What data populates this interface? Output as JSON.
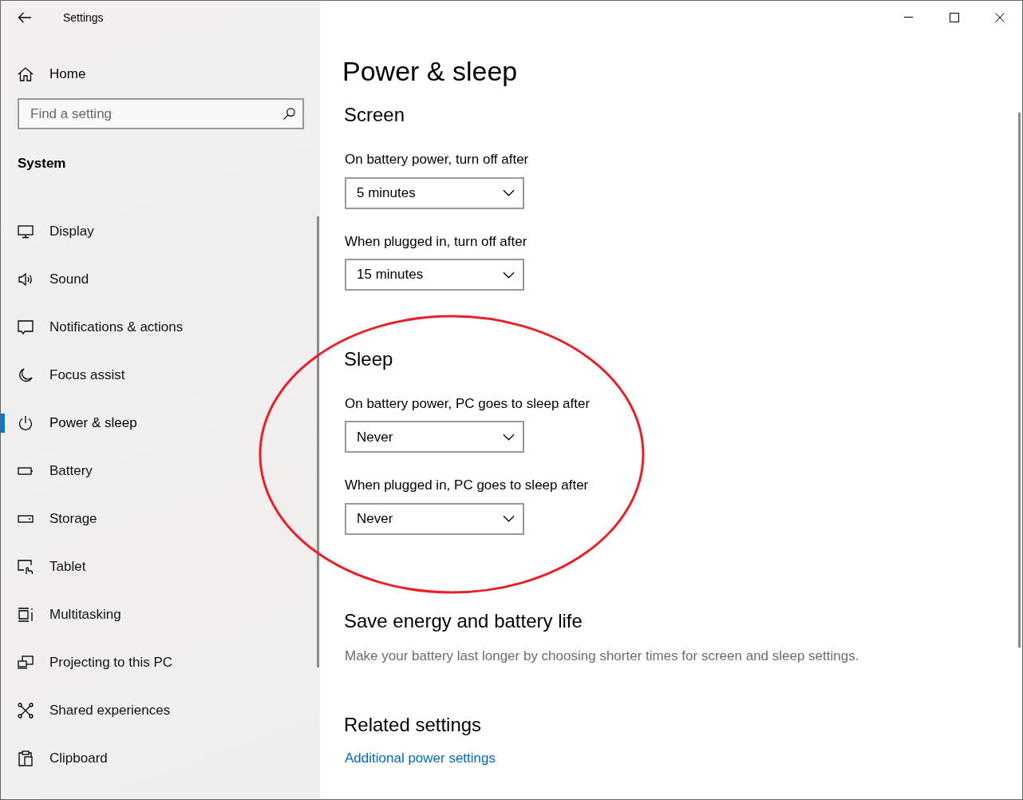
{
  "window": {
    "title": "Settings"
  },
  "sidebar": {
    "home": "Home",
    "search": {
      "placeholder": "Find a setting"
    },
    "section": "System",
    "items": [
      {
        "kind": "display",
        "label": "Display",
        "selected": false
      },
      {
        "kind": "sound",
        "label": "Sound",
        "selected": false
      },
      {
        "kind": "notifications",
        "label": "Notifications & actions",
        "selected": false
      },
      {
        "kind": "focus",
        "label": "Focus assist",
        "selected": false
      },
      {
        "kind": "power",
        "label": "Power & sleep",
        "selected": true
      },
      {
        "kind": "battery",
        "label": "Battery",
        "selected": false
      },
      {
        "kind": "storage",
        "label": "Storage",
        "selected": false
      },
      {
        "kind": "tablet",
        "label": "Tablet",
        "selected": false
      },
      {
        "kind": "multitasking",
        "label": "Multitasking",
        "selected": false
      },
      {
        "kind": "projecting",
        "label": "Projecting to this PC",
        "selected": false
      },
      {
        "kind": "shared",
        "label": "Shared experiences",
        "selected": false
      },
      {
        "kind": "clipboard",
        "label": "Clipboard",
        "selected": false
      }
    ]
  },
  "content": {
    "title": "Power & sleep",
    "sections": [
      {
        "kind": "dropdowns",
        "heading": "Screen",
        "settings": [
          {
            "label": "On battery power, turn off after",
            "value": "5 minutes"
          },
          {
            "label": "When plugged in, turn off after",
            "value": "15 minutes"
          }
        ]
      },
      {
        "kind": "dropdowns",
        "heading": "Sleep",
        "settings": [
          {
            "label": "On battery power, PC goes to sleep after",
            "value": "Never"
          },
          {
            "label": "When plugged in, PC goes to sleep after",
            "value": "Never"
          }
        ]
      },
      {
        "kind": "text",
        "heading": "Save energy and battery life",
        "description": "Make your battery last longer by choosing shorter times for screen and sleep settings."
      },
      {
        "kind": "link",
        "heading": "Related settings",
        "link": "Additional power settings"
      }
    ]
  },
  "annotation": {
    "kind": "ellipse",
    "color": "#e8202a"
  }
}
